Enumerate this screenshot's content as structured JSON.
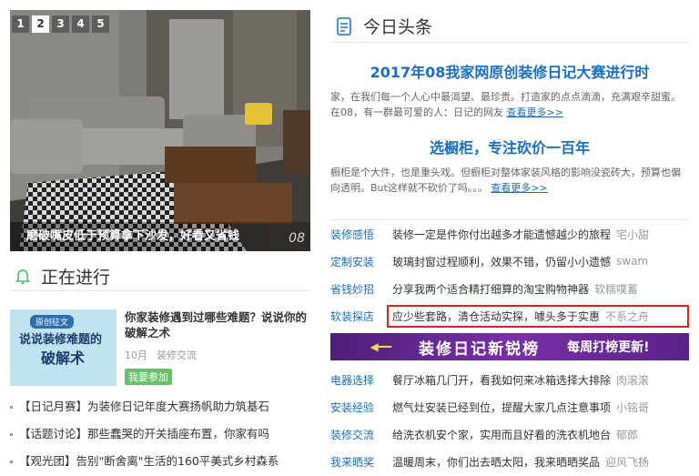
{
  "slider": {
    "pages": [
      "1",
      "2",
      "3",
      "4",
      "5"
    ],
    "active_page": "2",
    "caption": "磨破嘴皮低于预算拿下沙发，好看又省钱",
    "logo": "08"
  },
  "ongoing": {
    "title": "正在进行",
    "feature": {
      "thumb_tag": "原创征文",
      "thumb_line1": "说说装修难题的",
      "thumb_line2": "破解术",
      "title": "你家装修遇到过哪些难题？说说你的破解之术",
      "date": "10月",
      "category": "装修交流",
      "join_label": "我要参加"
    },
    "items": [
      "【日记月赛】为装修日记年度大赛扬帆助力筑基石",
      "【话题讨论】那些蠢哭的开关插座布置，你家有吗",
      "【观光团】告别\"断舍离\"生活的160平美式乡村森系"
    ]
  },
  "today": {
    "title": "今日头条",
    "headlines": [
      {
        "title": "2017年08我家网原创装修日记大赛进行时",
        "desc": "家，在我们每一个人心中最渴望、最珍贵。打造家的点点滴滴，充满艰辛甜蜜。在08，有一群最可爱的人：日记的网友",
        "more": "查看更多>>"
      },
      {
        "title": "选橱柜，专注砍价一百年",
        "desc": "橱柜是个大件，也是重头戏。但橱柜对整体家装风格的影响没瓷砖大，预算也偏向透明。But这样就不砍价了吗。。。",
        "more": "查看更多>>"
      }
    ],
    "list1": [
      {
        "cat": "装修感悟",
        "text": "装修一定是件你付出越多才能遗憾越少的旅程",
        "author": "宅小甜"
      },
      {
        "cat": "定制安装",
        "text": "玻璃封窗过程顺利，效果不错，仍留小小遗憾",
        "author": "swam"
      },
      {
        "cat": "省钱妙招",
        "text": "分享我两个适合精打细算的淘宝购物神器",
        "author": "软糯噗蓄"
      },
      {
        "cat": "软装探店",
        "text": "应少些套路，清仓活动实探，噱头多于实惠",
        "author": "不系之舟"
      }
    ],
    "banner": {
      "main": "装修日记新锐榜",
      "sub": "每周打榜更新!"
    },
    "list2": [
      {
        "cat": "电器选择",
        "text": "餐厅冰箱几门开，看我如何来冰箱选择大排除",
        "author": "肉滚滚"
      },
      {
        "cat": "安装经验",
        "text": "燃气灶安装已经到位，提醒大家几点注意事项",
        "author": "小铭哥"
      },
      {
        "cat": "装修交流",
        "text": "给洗衣机安个家，实用而且好看的洗衣机地台",
        "author": "郁郎"
      },
      {
        "cat": "我来晒奖",
        "text": "温暖周末，你们出去晒太阳，我来晒晒奖品",
        "author": "迎风飞扬"
      }
    ]
  }
}
